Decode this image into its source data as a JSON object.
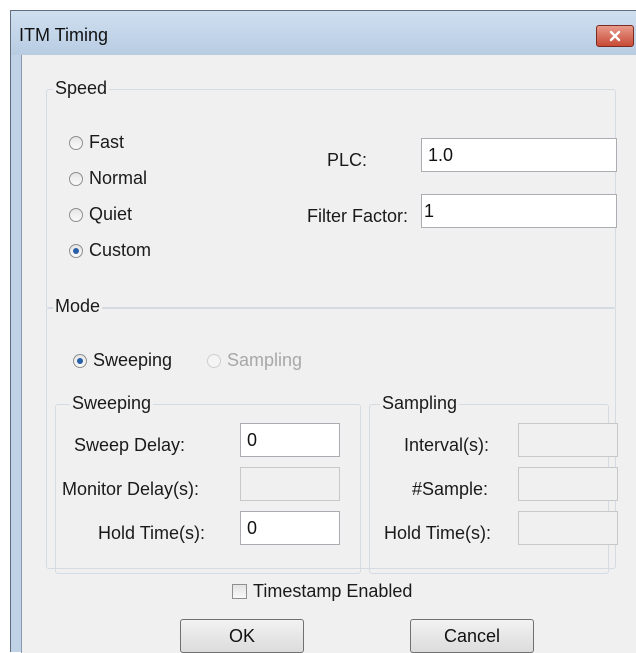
{
  "window": {
    "title": "ITM Timing"
  },
  "speed": {
    "label": "Speed",
    "options": [
      "Fast",
      "Normal",
      "Quiet",
      "Custom"
    ],
    "selected": "Custom",
    "plc_label": "PLC:",
    "plc_value": "1.0",
    "filter_label": "Filter Factor:",
    "filter_value": "1"
  },
  "mode": {
    "label": "Mode",
    "sweeping_option": "Sweeping",
    "sampling_option": "Sampling",
    "selected": "Sweeping",
    "sweeping": {
      "label": "Sweeping",
      "sweep_delay_label": "Sweep Delay:",
      "sweep_delay_value": "0",
      "monitor_delay_label": "Monitor Delay(s):",
      "monitor_delay_value": "",
      "hold_time_label": "Hold Time(s):",
      "hold_time_value": "0"
    },
    "sampling": {
      "label": "Sampling",
      "interval_label": "Interval(s):",
      "interval_value": "",
      "sample_label": "#Sample:",
      "sample_value": "",
      "hold_time_label": "Hold Time(s):",
      "hold_time_value": ""
    }
  },
  "timestamp": {
    "label": "Timestamp Enabled",
    "checked": false
  },
  "buttons": {
    "ok": "OK",
    "cancel": "Cancel"
  },
  "icons": {
    "close": "close-icon"
  }
}
